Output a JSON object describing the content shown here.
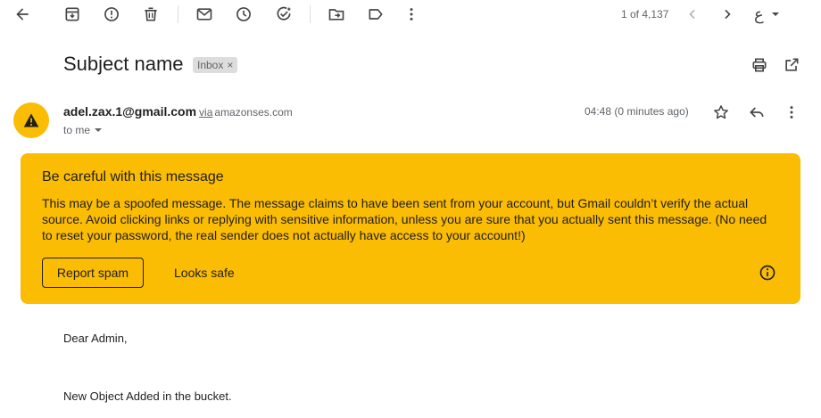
{
  "toolbar": {
    "counter": "1 of 4,137",
    "input_tool": "ع"
  },
  "message": {
    "subject": "Subject name",
    "label": "Inbox",
    "label_remove": "×",
    "sender_email": "adel.zax.1@gmail.com",
    "via": "via",
    "via_domain": "amazonses.com",
    "to": "to me",
    "time": "04:48 (0 minutes ago)"
  },
  "warning": {
    "title": "Be careful with this message",
    "body": "This may be a spoofed message. The message claims to have been sent from your account, but Gmail couldn’t verify the actual source. Avoid clicking links or replying with sensitive information, unless you are sure that you actually sent this message. (No need to reset your password, the real sender does not actually have access to your account!)",
    "report_label": "Report spam",
    "safe_label": "Looks safe"
  },
  "body": {
    "greeting": "Dear Admin,",
    "line1": "New Object Added in the bucket."
  },
  "colors": {
    "warning_bg": "#fbbc04",
    "icon": "#444746",
    "text": "#1f1f1f",
    "muted": "#5f6368"
  }
}
